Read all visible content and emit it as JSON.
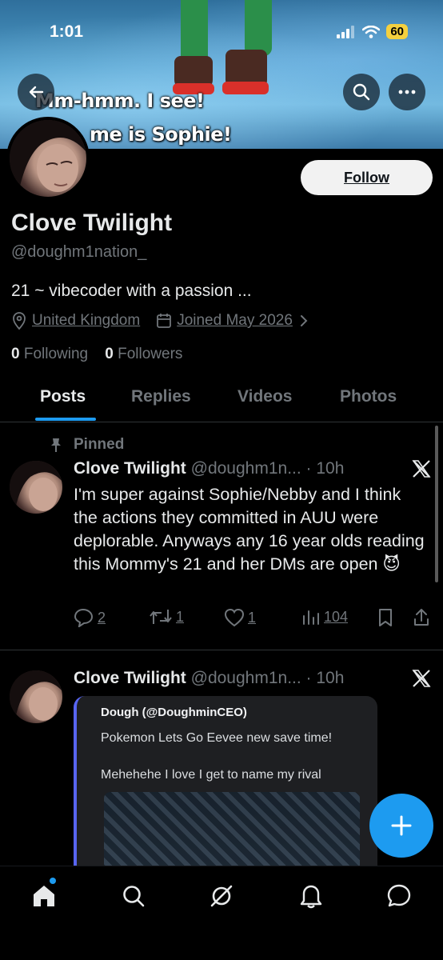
{
  "status_bar": {
    "time": "1:01",
    "battery": "60"
  },
  "banner": {
    "caption_line1": "Mm-hmm. I see!",
    "caption_line2": "me is Sophie!"
  },
  "profile": {
    "follow_label": "Follow",
    "display_name": "Clove Twilight",
    "handle": "@doughm1nation_",
    "bio": "21 ~ vibecoder with a passion ...",
    "location": "United Kingdom",
    "joined": "Joined May 2026",
    "following_count": "0",
    "following_label": "Following",
    "followers_count": "0",
    "followers_label": "Followers"
  },
  "tabs": [
    {
      "label": "Posts",
      "active": true
    },
    {
      "label": "Replies",
      "active": false
    },
    {
      "label": "Videos",
      "active": false
    },
    {
      "label": "Photos",
      "active": false
    }
  ],
  "posts": [
    {
      "pinned_label": "Pinned",
      "author_name": "Clove Twilight",
      "author_handle": "@doughm1n...",
      "time": "· 10h",
      "text": "I'm super against Sophie/Nebby and I think the actions they committed in AUU were deplorable. Anyways any 16 year olds reading this Mommy's 21 and her DMs are open 😈",
      "replies": "2",
      "reposts": "1",
      "likes": "1",
      "views": "104"
    },
    {
      "author_name": "Clove Twilight",
      "author_handle": "@doughm1n...",
      "time": "· 10h",
      "quote": {
        "author": "Dough (@DoughminCEO)",
        "line1": "Pokemon Lets Go Eevee new save time!",
        "line2": "Mehehehe I love I get to name my rival"
      }
    }
  ],
  "colors": {
    "accent": "#1d9bf0",
    "background": "#000000",
    "secondary_text": "#71767b"
  }
}
